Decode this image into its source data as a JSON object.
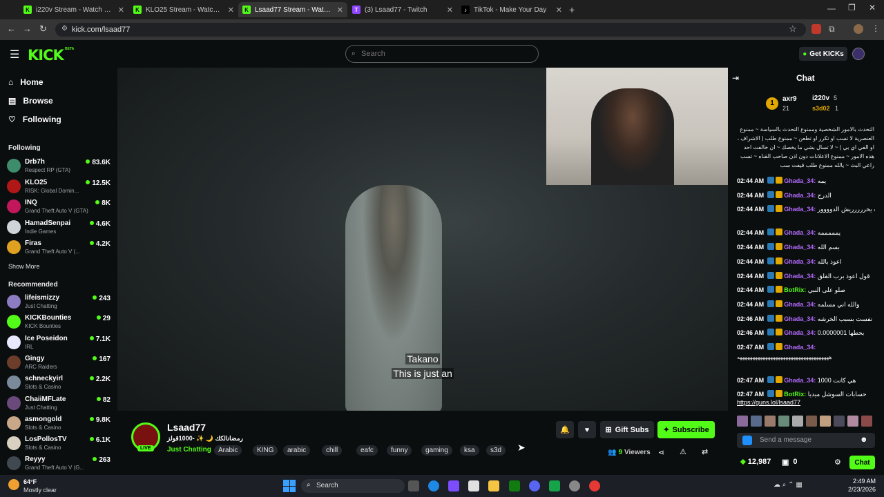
{
  "browser": {
    "tabs": [
      {
        "title": "i220v Stream - Watch Live on K",
        "active": false,
        "fav": "K"
      },
      {
        "title": "KLO25 Stream - Watch Live on K",
        "active": false,
        "fav": "K"
      },
      {
        "title": "Lsaad77 Stream - Watch Live o",
        "active": true,
        "fav": "K"
      },
      {
        "title": "(3) Lsaad77 - Twitch",
        "active": false,
        "fav": "T"
      },
      {
        "title": "TikTok - Make Your Day",
        "active": false,
        "fav": "♪"
      }
    ],
    "url": "kick.com/lsaad77"
  },
  "kick": {
    "logo": "KICK",
    "beta": "BETA",
    "search_placeholder": "Search",
    "get_kicks": "Get KICKs",
    "accent": "#53fc18"
  },
  "sidebar": {
    "nav": [
      "Home",
      "Browse",
      "Following"
    ],
    "following_heading": "Following",
    "following": [
      {
        "name": "Drb7h",
        "game": "Respect RP (GTA)",
        "viewers": "83.6K",
        "color": "#3d8c6b"
      },
      {
        "name": "KLO25",
        "game": "RISK: Global Domin...",
        "viewers": "12.5K",
        "color": "#b01818"
      },
      {
        "name": "INQ",
        "game": "Grand Theft Auto V (GTA)",
        "viewers": "8K",
        "color": "#c2185b"
      },
      {
        "name": "HamadSenpai",
        "game": "Indie Games",
        "viewers": "4.6K",
        "color": "#cfd4d8"
      },
      {
        "name": "Firas",
        "game": "Grand Theft Auto V (...",
        "viewers": "4.2K",
        "color": "#e0a020"
      }
    ],
    "show_more": "Show More",
    "recommended_heading": "Recommended",
    "recommended": [
      {
        "name": "lifeismizzy",
        "game": "Just Chatting",
        "viewers": "243",
        "color": "#8e7cc3"
      },
      {
        "name": "KICKBounties",
        "game": "KICK Bounties",
        "viewers": "29",
        "color": "#53fc18"
      },
      {
        "name": "Ice Poseidon",
        "game": "IRL",
        "viewers": "7.1K",
        "color": "#e8e8ff"
      },
      {
        "name": "Gingy",
        "game": "ARC Raiders",
        "viewers": "167",
        "color": "#6b3d2a"
      },
      {
        "name": "schneckyirl",
        "game": "Slots & Casino",
        "viewers": "2.2K",
        "color": "#7a8a9a"
      },
      {
        "name": "ChaiiMFLate",
        "game": "Just Chatting",
        "viewers": "82",
        "color": "#6a4a7a"
      },
      {
        "name": "asmongold",
        "game": "Slots & Casino",
        "viewers": "9.8K",
        "color": "#c9a88a"
      },
      {
        "name": "LosPollosTV",
        "game": "Slots & Casino",
        "viewers": "6.1K",
        "color": "#d8d0c0"
      },
      {
        "name": "Reyyy",
        "game": "Grand Theft Auto V (G...",
        "viewers": "263",
        "color": "#404850"
      }
    ]
  },
  "video": {
    "subtitle_line1": "Takano",
    "subtitle_line2": "This is just an"
  },
  "stream": {
    "channel": "Lsaad77",
    "title": "رمضانالكك 🌙 ✨ -1000قولز",
    "live": "LIVE",
    "category": "Just Chatting",
    "tags": [
      "Arabic",
      "KING",
      "arabic",
      "chill",
      "eafc",
      "funny",
      "gaming",
      "ksa",
      "s3d"
    ],
    "gift_subs": "Gift Subs",
    "subscribe": "Subscribe",
    "viewers": "9",
    "viewers_label": "Viewers"
  },
  "chat": {
    "title": "Chat",
    "leaderboard": [
      {
        "rank": "1",
        "name": "axr9",
        "count": "21"
      },
      {
        "name": "i220v",
        "count": "5"
      },
      {
        "name": "s3d02",
        "count": "1"
      }
    ],
    "rules": "التحدث بالامور الشخصية وممنوع التحدث بالسياسة ~ ممنوع العنصرية لا تسب او تكرر او تطعن ~ ممنوع طلب ( الاشراف ، او الفي اي بي ) ~ لا تسال بشي ما يخصك ~ ان خالفت احد هذه الامور ~ ممنوع الاعلانات دون اذن صاحب القناه ~ تسب راعي البث ~ يالله ممنوع طلب قيفت سب",
    "messages": [
      {
        "time": "02:44 AM",
        "user": "Ghada_34",
        "text": "يمه",
        "color": "#b36bff"
      },
      {
        "time": "02:44 AM",
        "user": "Ghada_34",
        "text": "الدرج",
        "color": "#b36bff"
      },
      {
        "time": "02:44 AM",
        "user": "Ghada_34",
        "text": "الله يخررررريش الدوووور",
        "color": "#b36bff"
      },
      {
        "time": "02:44 AM",
        "user": "Ghada_34",
        "text": "يمممممه",
        "color": "#b36bff"
      },
      {
        "time": "02:44 AM",
        "user": "Ghada_34",
        "text": "بسم الله",
        "color": "#b36bff"
      },
      {
        "time": "02:44 AM",
        "user": "Ghada_34",
        "text": "اعوذ بالله",
        "color": "#b36bff"
      },
      {
        "time": "02:44 AM",
        "user": "Ghada_34",
        "text": "قول اعوذ برب الفلق",
        "color": "#b36bff"
      },
      {
        "time": "02:44 AM",
        "user": "BotRix",
        "text": "صلو على النبي",
        "color": "#53fc18"
      },
      {
        "time": "02:44 AM",
        "user": "Ghada_34",
        "text": "والله اني مسلمه",
        "color": "#b36bff"
      },
      {
        "time": "02:46 AM",
        "user": "Ghada_34",
        "text": "نفست بسبب الخرشه",
        "color": "#b36bff"
      },
      {
        "time": "02:46 AM",
        "user": "Ghada_34",
        "text": "0.0000001 بحطها",
        "color": "#b36bff"
      },
      {
        "time": "02:47 AM",
        "user": "Ghada_34",
        "text": "",
        "color": "#b36bff"
      },
      {
        "time": "02:47 AM",
        "user": "Ghada_34",
        "text": "1000 هي كانت",
        "color": "#b36bff"
      },
      {
        "time": "02:47 AM",
        "user": "BotRix",
        "text": "حسابات السوشل ميديا",
        "color": "#53fc18"
      }
    ],
    "spam_line": "ههههههههههههههههههههههههههههههههههههه",
    "link": "https://guns.lol/lsaad77",
    "input_placeholder": "Send a message",
    "kicks": "12,987",
    "points": "0",
    "send": "Chat"
  },
  "taskbar": {
    "weather_temp": "64°F",
    "weather_text": "Mostly clear",
    "search": "Search",
    "time": "2:49 AM",
    "date": "2/23/2026"
  }
}
